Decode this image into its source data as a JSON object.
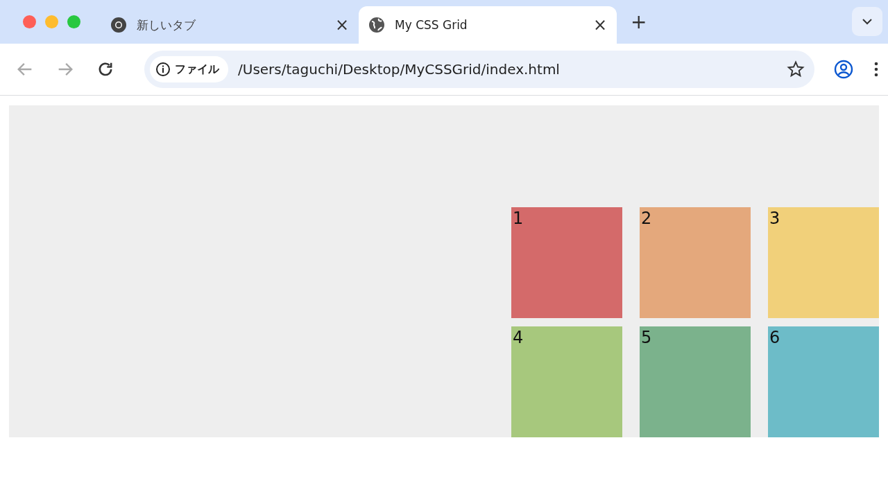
{
  "tabs": [
    {
      "title": "新しいタブ",
      "kind": "chrome",
      "selected": false,
      "close": "×"
    },
    {
      "title": "My CSS Grid",
      "kind": "globe",
      "selected": true,
      "close": "×"
    }
  ],
  "new_tab": "+",
  "toolbar": {
    "nav": [
      {
        "kind": "back",
        "disabled": true
      },
      {
        "kind": "forward",
        "disabled": true
      },
      {
        "kind": "reload",
        "disabled": false
      }
    ],
    "site_chip": "ファイル",
    "url": "/Users/taguchi/Desktop/MyCSSGrid/index.html"
  },
  "grid_items": [
    {
      "label": "1",
      "color": "#d46a6a"
    },
    {
      "label": "2",
      "color": "#e4a87c"
    },
    {
      "label": "3",
      "color": "#f1d07a"
    },
    {
      "label": "4",
      "color": "#a7c87d"
    },
    {
      "label": "5",
      "color": "#7bb28c"
    },
    {
      "label": "6",
      "color": "#6dbcc8"
    }
  ]
}
